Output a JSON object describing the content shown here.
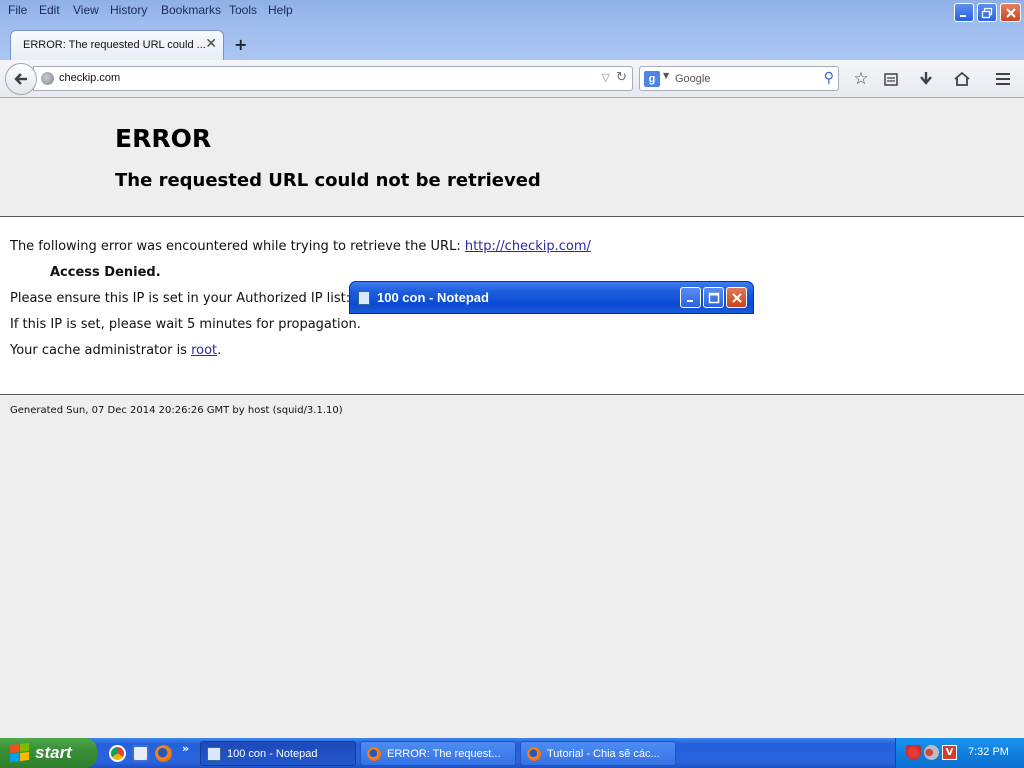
{
  "menubar": {
    "items": [
      {
        "label": "File"
      },
      {
        "label": "Edit"
      },
      {
        "label": "View"
      },
      {
        "label": "History"
      },
      {
        "label": "Bookmarks"
      },
      {
        "label": "Tools"
      },
      {
        "label": "Help"
      }
    ]
  },
  "tab": {
    "title": "ERROR: The requested URL could ...",
    "close": "✕",
    "new_tab": "+"
  },
  "navbar": {
    "url": "checkip.com",
    "search_placeholder": "Google",
    "search_engine_letter": "g"
  },
  "page": {
    "title": "ERROR",
    "subtitle": "The requested URL could not be retrieved",
    "line1_prefix": "The following error was encountered while trying to retrieve the URL: ",
    "line1_link": "http://checkip.com/",
    "access_denied": "Access Denied.",
    "line2": "Please ensure this IP is set in your Authorized IP list:",
    "line3": "If this IP is set, please wait 5 minutes for propagation.",
    "line4_prefix": "Your cache administrator is ",
    "line4_link": "root",
    "line4_suffix": ".",
    "footer": "Generated Sun, 07 Dec 2014 20:26:26 GMT by host (squid/3.1.10)"
  },
  "notepad": {
    "title": "100 con - Notepad"
  },
  "taskbar": {
    "start_label": "start",
    "more": "»",
    "tasks": [
      {
        "label": "100 con - Notepad"
      },
      {
        "label": "ERROR: The request..."
      },
      {
        "label": "Tutorial - Chia sẽ các..."
      }
    ],
    "clock": "7:32 PM"
  },
  "colors": {
    "link": "#2b2b9c",
    "xp_blue": "#2660da",
    "start_green": "#3a8f37",
    "close_red": "#c9471f"
  }
}
